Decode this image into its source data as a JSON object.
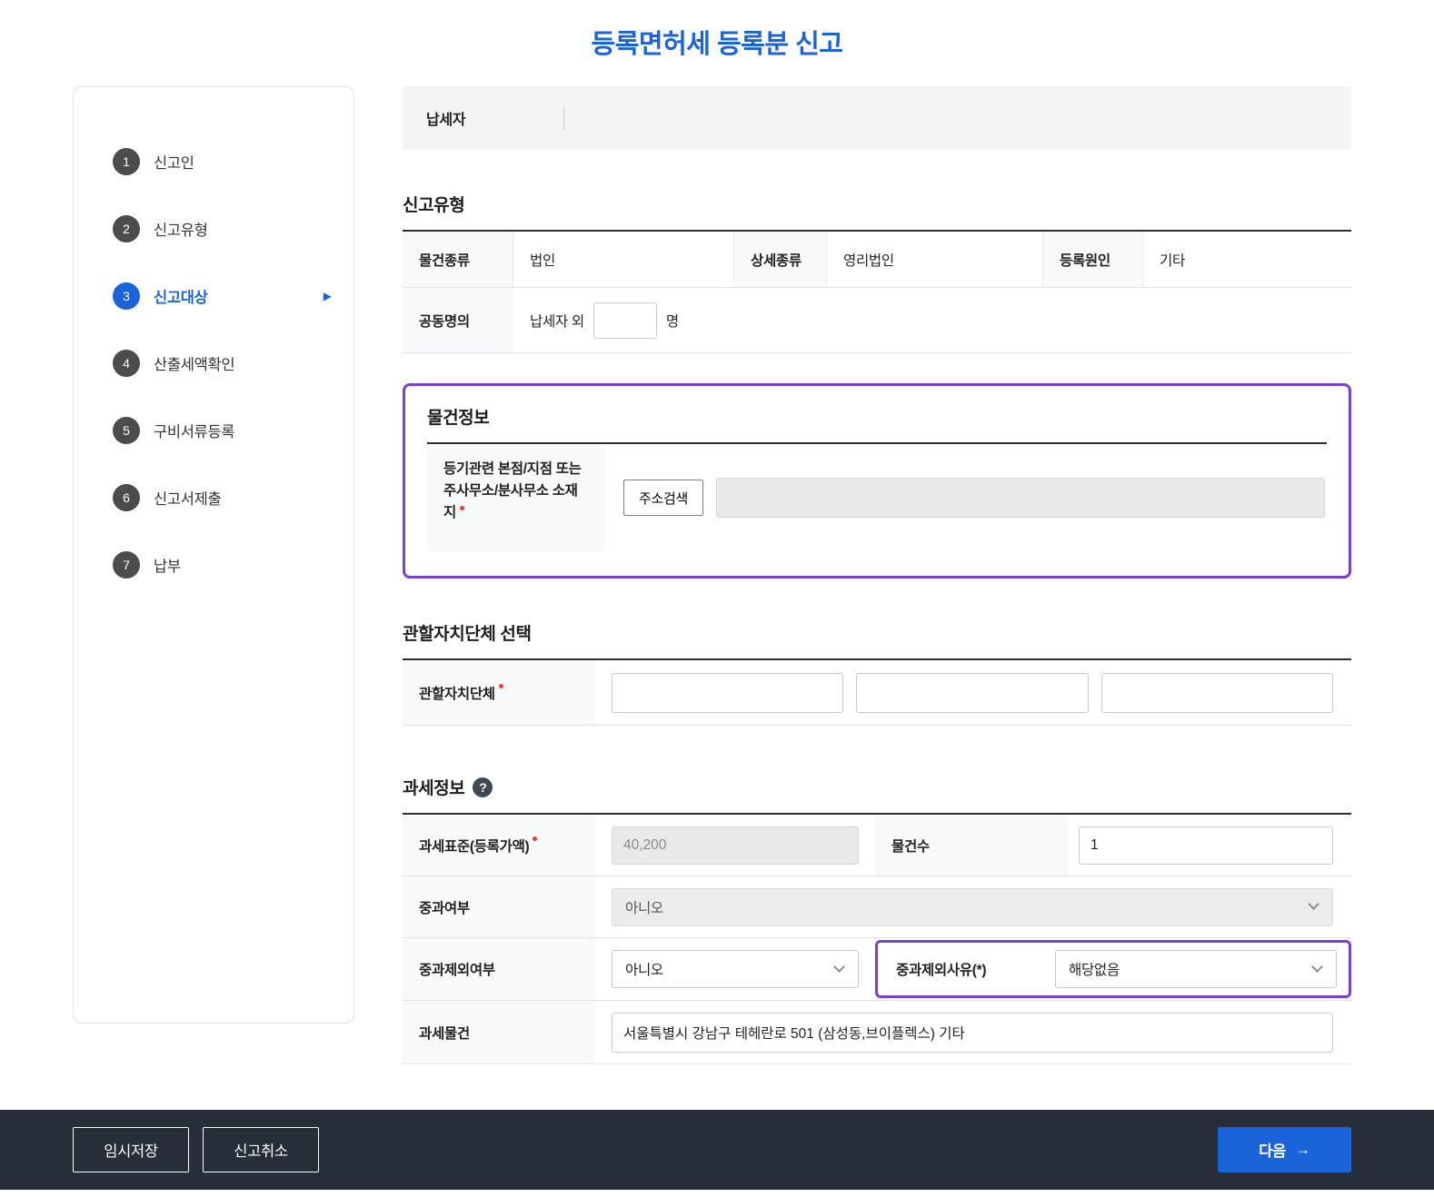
{
  "page": {
    "title": "등록면허세 등록분 신고"
  },
  "colors": {
    "accent_blue": "#1a63d9",
    "highlight_purple": "#7c3fd4",
    "footer_bg": "#272e3a",
    "required_red": "#e8412e"
  },
  "icons": {
    "help": "?",
    "active_step_arrow": "▶",
    "next_arrow": "→"
  },
  "stepper": {
    "active_index": 2,
    "items": [
      {
        "num": "1",
        "label": "신고인"
      },
      {
        "num": "2",
        "label": "신고유형"
      },
      {
        "num": "3",
        "label": "신고대상"
      },
      {
        "num": "4",
        "label": "산출세액확인"
      },
      {
        "num": "5",
        "label": "구비서류등록"
      },
      {
        "num": "6",
        "label": "신고서제출"
      },
      {
        "num": "7",
        "label": "납부"
      }
    ]
  },
  "taxpayer": {
    "label": "납세자",
    "value": ""
  },
  "report_type": {
    "title": "신고유형",
    "property_kind_label": "물건종류",
    "property_kind_value": "법인",
    "detail_kind_label": "상세종류",
    "detail_kind_value": "영리법인",
    "cause_label": "등록원인",
    "cause_value": "기타",
    "joint_label": "공동명의",
    "joint_prefix": "납세자 외",
    "joint_count_value": "",
    "joint_suffix": "명"
  },
  "property_info": {
    "title": "물건정보",
    "address_label": "등기관련 본점/지점 또는 주사무소/분사무소 소재지",
    "address_search_button": "주소검색",
    "address_value": ""
  },
  "district": {
    "title": "관할자치단체 선택",
    "label": "관할자치단체",
    "values": [
      "",
      "",
      ""
    ]
  },
  "tax_info": {
    "title": "과세정보",
    "tax_base_label": "과세표준(등록가액)",
    "tax_base_value": "40,200",
    "object_count_label": "물건수",
    "object_count_value": "1",
    "surtax_label": "중과여부",
    "surtax_value": "아니오",
    "surtax_exclusion_label": "중과제외여부",
    "surtax_exclusion_value": "아니오",
    "exclusion_reason_label": "중과제외사유(*)",
    "exclusion_reason_value": "해당없음",
    "taxable_object_label": "과세물건",
    "taxable_object_value": "서울특별시 강남구 테헤란로 501 (삼성동,브이플렉스) 기타"
  },
  "footer": {
    "temp_save_label": "임시저장",
    "cancel_label": "신고취소",
    "next_label": "다음"
  }
}
